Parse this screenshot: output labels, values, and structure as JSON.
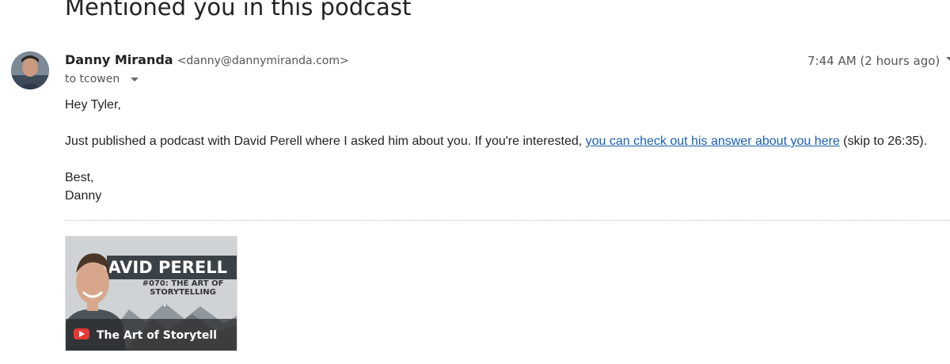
{
  "email": {
    "subject": "Mentioned you in this podcast",
    "sender": {
      "name": "Danny Miranda",
      "email": "<danny@dannymiranda.com>"
    },
    "recipient": "to tcowen",
    "timestamp": "7:44 AM (2 hours ago)",
    "body": {
      "greeting": "Hey Tyler,",
      "paragraph_before_link": "Just published a podcast with David Perell where I asked him about you. If you're interested, ",
      "link_text": "you can check out his answer about you here",
      "paragraph_after_link": " (skip to 26:35).",
      "signoff": "Best,",
      "signature": "Danny"
    }
  },
  "attachment": {
    "title_name": "DAVID PERELL",
    "episode_line1": "#070: THE ART OF",
    "episode_line2": "STORYTELLING",
    "video_title": "The Art of Storytell",
    "icon": "youtube-play-icon"
  }
}
